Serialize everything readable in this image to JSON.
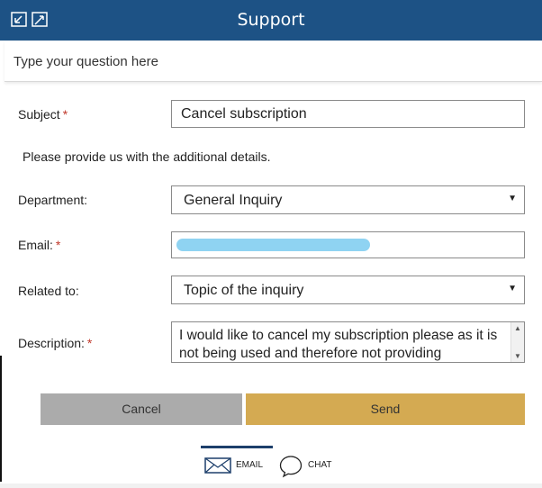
{
  "header": {
    "title": "Support",
    "icons": [
      "minimize-icon",
      "expand-icon"
    ]
  },
  "question": {
    "placeholder": "Type your question here"
  },
  "form": {
    "subject_label": "Subject",
    "subject_value": "Cancel subscription",
    "info_text": "Please provide us with the additional details.",
    "department_label": "Department:",
    "department_value": "General Inquiry",
    "email_label": "Email:",
    "email_value": "",
    "related_label": "Related to:",
    "related_value": "Topic of the inquiry",
    "description_label": "Description:",
    "description_value": "I would like to cancel my subscription please as it is not being used and therefore not providing",
    "required_marker": "*"
  },
  "buttons": {
    "cancel": "Cancel",
    "send": "Send"
  },
  "tabs": [
    {
      "label": "EMAIL",
      "icon": "envelope-icon",
      "active": true
    },
    {
      "label": "CHAT",
      "icon": "chat-bubble-icon",
      "active": false
    }
  ],
  "colors": {
    "header": "#1d5285",
    "send": "#d4aa52",
    "cancel": "#ababab",
    "required": "#c0392b",
    "redaction": "#8fd3f2"
  }
}
